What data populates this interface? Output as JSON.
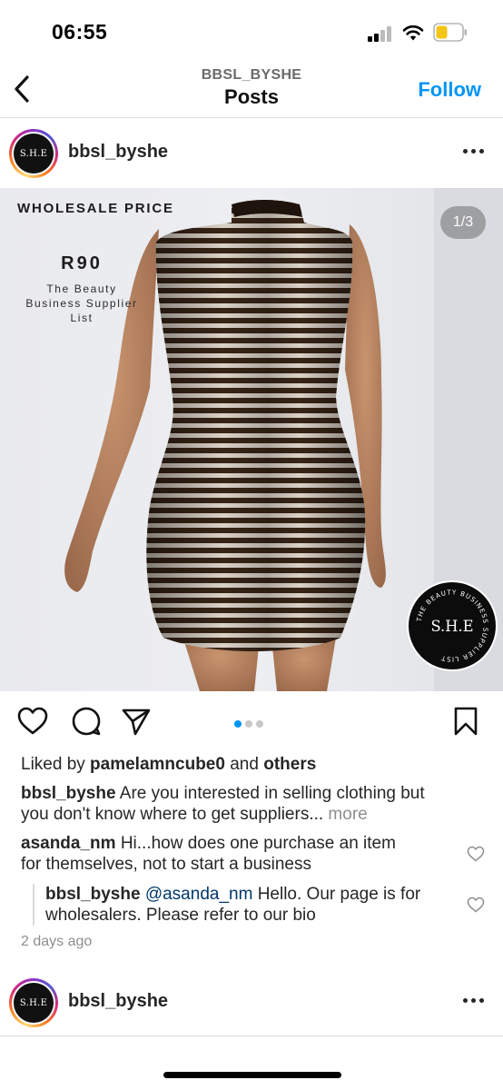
{
  "status_bar": {
    "time": "06:55"
  },
  "nav": {
    "subtitle": "BBSL_BYSHE",
    "title": "Posts",
    "follow_label": "Follow"
  },
  "post": {
    "username": "bbsl_byshe",
    "avatar_text": "S.H.E",
    "image": {
      "wholesale_label": "WHOLESALE PRICE",
      "price": "R90",
      "supplier_line1": "The Beauty",
      "supplier_line2": "Business Supplier",
      "supplier_line3": "List",
      "counter": "1/3",
      "badge_text": "S.H.E",
      "badge_ring_text": "THE BEAUTY BUSINESS SUPPLIER LIST"
    },
    "carousel": {
      "count": 3,
      "active_index": 0
    },
    "likes": {
      "prefix": "Liked by ",
      "user": "pamelamncube0",
      "middle": " and ",
      "suffix": "others"
    },
    "caption": {
      "user": "bbsl_byshe",
      "line1": " Are you interested in selling clothing but",
      "line2": "you don't know where to get suppliers...",
      "more": " more"
    },
    "comments": [
      {
        "user": "asanda_nm",
        "line1": " Hi...how does one purchase an item",
        "line2": "for themselves, not to start a business"
      },
      {
        "user": "bbsl_byshe",
        "mention": "@asanda_nm",
        "line1": " Hello. Our page is for",
        "line2": "wholesalers. Please refer to our bio"
      }
    ],
    "time_ago": "2 days ago"
  },
  "next_post": {
    "username": "bbsl_byshe",
    "avatar_text": "S.H.E"
  },
  "colors": {
    "accent": "#0095f6",
    "text": "#262626",
    "muted": "#8e8e8e",
    "mention": "#00376b"
  }
}
